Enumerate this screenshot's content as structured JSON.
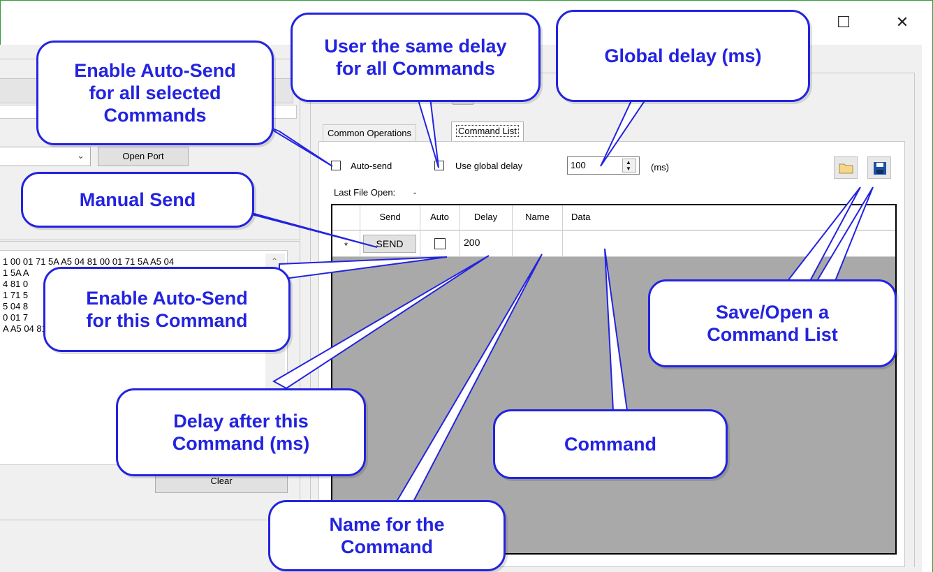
{
  "window": {
    "maximize_icon": "maximize-icon",
    "close_icon": "close-icon"
  },
  "left": {
    "open_port_label": "Open Port",
    "clear_label": "Clear",
    "hex_lines": [
      "1 00 01 71 5A A5 04 81 00 01 71 5A A5 04",
      "1 5A A",
      "4 81 0",
      "1 71 5",
      "5 04 8",
      "0 01 7",
      "A A5 04 81 00 01 71 5A A5 04 81 00 01 71"
    ]
  },
  "right": {
    "tabs": [
      "Common Operations",
      "Command List"
    ],
    "auto_send_label": "Auto-send",
    "use_global_delay_label": "Use global delay",
    "global_delay_value": "100",
    "ms_label": "(ms)",
    "last_file_label": "Last File Open:",
    "last_file_value": "-",
    "grid": {
      "columns": [
        "Send",
        "Auto",
        "Delay",
        "Name",
        "Data"
      ],
      "row_marker": "*",
      "row": {
        "send": "SEND",
        "delay": "200",
        "name": "",
        "data": ""
      }
    }
  },
  "callouts": {
    "enable_all": [
      "Enable Auto-Send",
      "for all selected",
      "Commands"
    ],
    "same_delay": [
      "User the same delay",
      "for all Commands"
    ],
    "global_delay": [
      "Global delay (ms)"
    ],
    "manual_send": [
      "Manual Send"
    ],
    "enable_this": [
      "Enable Auto-Send",
      "for this Command"
    ],
    "delay_after": [
      "Delay after this",
      "Command (ms)"
    ],
    "save_open": [
      "Save/Open a",
      "Command List"
    ],
    "command": [
      "Command"
    ],
    "name_for": [
      "Name for the",
      "Command"
    ]
  },
  "colors": {
    "callout_blue": "#2323e0",
    "grid_gray": "#a9a9a9",
    "window_border": "#2e9c3a"
  }
}
